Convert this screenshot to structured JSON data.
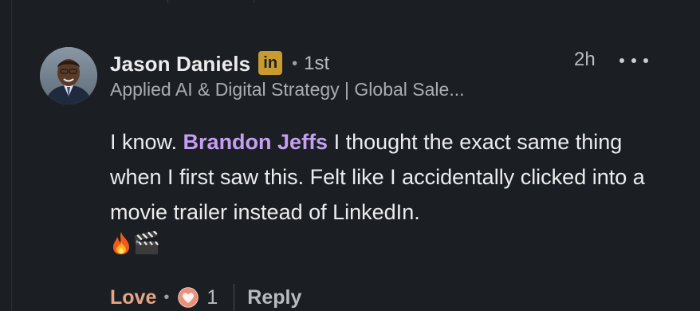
{
  "comment": {
    "author": {
      "name": "Jason Daniels",
      "badge": "in",
      "degree": "1st",
      "headline": "Applied AI & Digital Strategy | Global Sale..."
    },
    "timestamp": "2h",
    "body": {
      "before_mention": "I know. ",
      "mention": "Brandon Jeffs",
      "after_mention": " I thought the exact same thing when I first saw this. Felt like I accidentally clicked into a movie trailer instead of LinkedIn."
    },
    "actions": {
      "love_label": "Love",
      "reaction_count": "1",
      "reply_label": "Reply"
    }
  },
  "colors": {
    "background": "#1b1f23",
    "mention": "#c5a0f2",
    "love": "#e8a584",
    "badge": "#c99a2e"
  },
  "icons": [
    "linkedin-badge-icon",
    "more-options-icon",
    "fire-emoji-icon",
    "clapperboard-emoji-icon",
    "love-reaction-icon"
  ]
}
